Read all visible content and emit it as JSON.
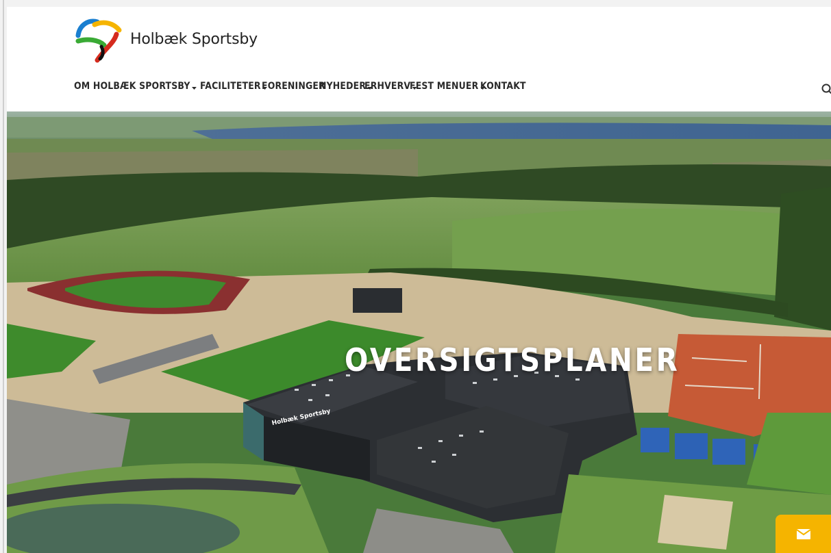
{
  "brand": {
    "name": "Holbæk Sportsby",
    "colors": {
      "blue": "#1a7fd0",
      "yellow": "#f5b400",
      "green": "#3aaa35",
      "red": "#d52b1e",
      "black": "#111111"
    }
  },
  "nav": {
    "items": [
      {
        "label": "OM HOLBÆK SPORTSBY",
        "dropdown": true
      },
      {
        "label": "FACILITETER",
        "dropdown": true
      },
      {
        "label": "FORENINGER",
        "dropdown": false
      },
      {
        "label": "NYHEDER",
        "dropdown": true
      },
      {
        "label": "ERHVERV",
        "dropdown": true
      },
      {
        "label": "FEST MENUER",
        "dropdown": true
      },
      {
        "label": "KONTAKT",
        "dropdown": false
      }
    ],
    "search_icon": "search-icon"
  },
  "hero": {
    "title": "OVERSIGTSPLANER",
    "building_sign": "Holbæk Sportsby"
  },
  "contact_tab": {
    "icon": "envelope-icon",
    "color": "#f5b400"
  }
}
